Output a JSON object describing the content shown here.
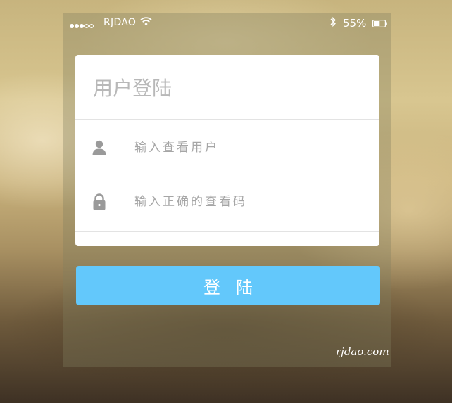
{
  "status_bar": {
    "signal_strength": 3,
    "signal_total": 5,
    "carrier": "RJDAO",
    "wifi_icon": "wifi-icon",
    "bluetooth_icon": "bluetooth-icon",
    "battery_percent_label": "55%",
    "battery_level": 0.55
  },
  "login_card": {
    "title": "用户登陆",
    "username": {
      "icon": "user-icon",
      "placeholder": "输入查看用户",
      "value": ""
    },
    "password": {
      "icon": "lock-icon",
      "placeholder": "输入正确的查看码",
      "value": ""
    }
  },
  "login_button": {
    "label": "登陆",
    "color": "#63c8fb"
  },
  "watermark": "rjdao.com",
  "colors": {
    "card_background": "#ffffff",
    "placeholder_text": "#a6a6a6",
    "icon_gray": "#9a9a9a"
  }
}
